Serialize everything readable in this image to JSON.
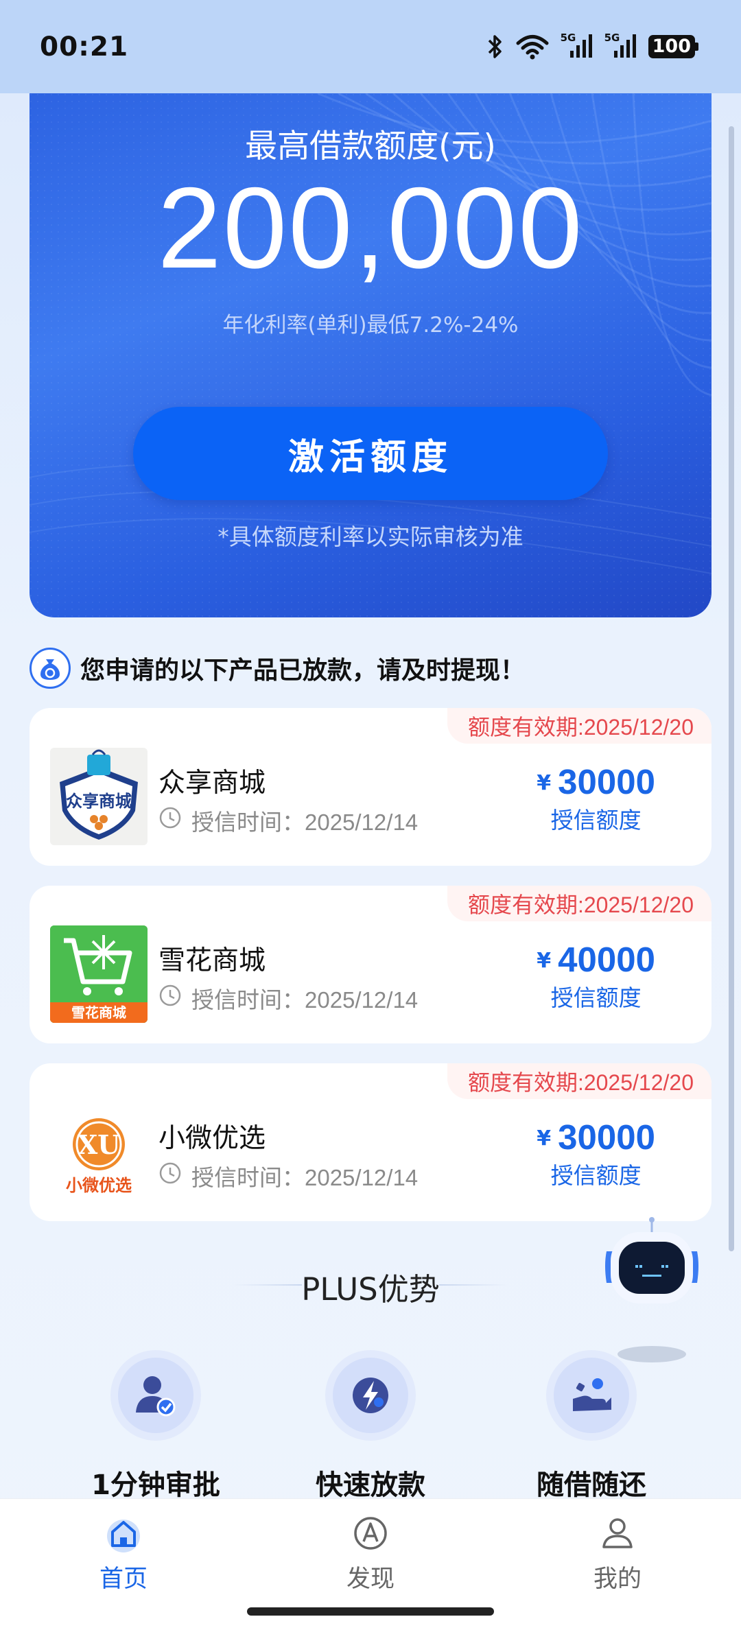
{
  "status_bar": {
    "time": "00:21",
    "battery": "100",
    "signal_1_tag": "5G",
    "signal_2_tag": "5G"
  },
  "hero": {
    "label": "最高借款额度(元)",
    "amount": "200,000",
    "rate_text": "年化利率(单利)最低7.2%-24%",
    "activate_label": "激活额度",
    "note": "*具体额度利率以实际审核为准"
  },
  "notice": {
    "text": "您申请的以下产品已放款，请及时提现！"
  },
  "products": [
    {
      "name": "众享商城",
      "expiry": "额度有效期:2025/12/20",
      "credit_time": "授信时间：2025/12/14",
      "currency": "¥",
      "amount": "30000",
      "amount_label": "授信额度",
      "logo_text": "众享商城"
    },
    {
      "name": "雪花商城",
      "expiry": "额度有效期:2025/12/20",
      "credit_time": "授信时间：2025/12/14",
      "currency": "¥",
      "amount": "40000",
      "amount_label": "授信额度",
      "logo_text": "雪花商城"
    },
    {
      "name": "小微优选",
      "expiry": "额度有效期:2025/12/20",
      "credit_time": "授信时间：2025/12/14",
      "currency": "¥",
      "amount": "30000",
      "amount_label": "授信额度",
      "logo_text": "小微优选"
    }
  ],
  "plus": {
    "title": "PLUS优势",
    "features": [
      {
        "label": "1分钟审批",
        "icon": "user-check-icon"
      },
      {
        "label": "快速放款",
        "icon": "lightning-icon"
      },
      {
        "label": "随借随还",
        "icon": "hand-coin-icon"
      }
    ]
  },
  "bottom_nav": {
    "items": [
      {
        "label": "首页",
        "icon": "home-icon"
      },
      {
        "label": "发现",
        "icon": "compass-icon"
      },
      {
        "label": "我的",
        "icon": "person-icon"
      }
    ]
  },
  "colors": {
    "accent": "#1a66e6",
    "button": "#0b63f6",
    "expiry": "#e5484d"
  }
}
